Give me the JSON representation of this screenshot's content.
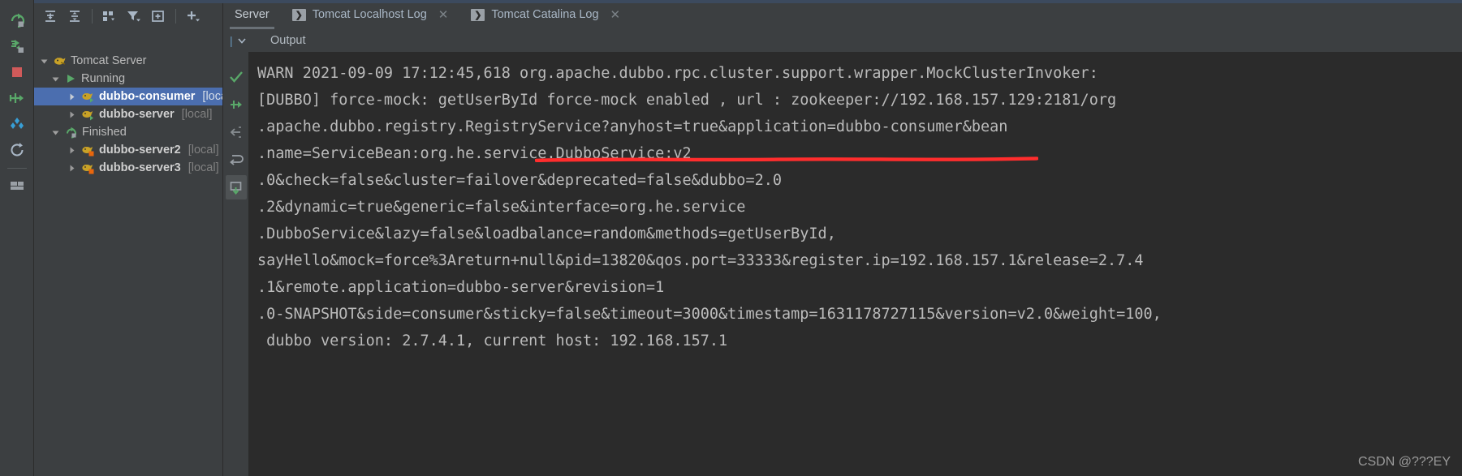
{
  "window": {
    "accent_selection": "#4b6eaf",
    "console_bg": "#2b2b2b",
    "panel_bg": "#3c3f41",
    "text_color": "#bbbbbb",
    "annotation_color": "#ff2d2d"
  },
  "left_rail": {
    "items": [
      {
        "name": "rerun-icon",
        "title": "Rerun"
      },
      {
        "name": "rerun-failed-tests-icon",
        "title": "Debug"
      },
      {
        "name": "stop-icon",
        "title": "Stop"
      },
      {
        "name": "deploy-icon",
        "title": "Deploy"
      },
      {
        "name": "edit-configurations-icon",
        "title": "Edit Configurations"
      },
      {
        "name": "restart-icon",
        "title": "Restart Server"
      },
      {
        "name": "layout-icon",
        "title": "Layout Settings"
      }
    ]
  },
  "tree_toolbar": {
    "items": [
      {
        "name": "expand-all-icon",
        "title": "Expand All"
      },
      {
        "name": "collapse-all-icon",
        "title": "Collapse All"
      },
      {
        "name": "group-by-icon",
        "title": "Group By"
      },
      {
        "name": "filter-icon",
        "title": "Filter"
      },
      {
        "name": "add-frame-icon",
        "title": "Add Frame"
      },
      {
        "name": "add-icon",
        "title": "Add"
      }
    ]
  },
  "tabs": [
    {
      "label": "Server",
      "active": true,
      "closable": false,
      "has_run_icon": false
    },
    {
      "label": "Tomcat Localhost Log",
      "active": false,
      "closable": true,
      "has_run_icon": true
    },
    {
      "label": "Tomcat Catalina Log",
      "active": false,
      "closable": true,
      "has_run_icon": true
    }
  ],
  "subbar": {
    "collapse_icon": "chevron-down-icon",
    "output_label": "Output"
  },
  "tree": {
    "nodes": [
      {
        "level": 0,
        "twisty": "down",
        "icon": "tomcat-icon",
        "label": "Tomcat Server",
        "sub": "",
        "bold": false,
        "selected": false
      },
      {
        "level": 1,
        "twisty": "down",
        "icon": "run-green-icon",
        "label": "Running",
        "sub": "",
        "bold": false,
        "selected": false
      },
      {
        "level": 2,
        "twisty": "right",
        "icon": "tomcat-run-icon",
        "label": "dubbo-consumer",
        "sub": "[local]",
        "bold": true,
        "selected": true
      },
      {
        "level": 2,
        "twisty": "right",
        "icon": "tomcat-run-icon",
        "label": "dubbo-server",
        "sub": "[local]",
        "bold": true,
        "selected": false
      },
      {
        "level": 1,
        "twisty": "down",
        "icon": "finished-icon",
        "label": "Finished",
        "sub": "",
        "bold": false,
        "selected": false
      },
      {
        "level": 2,
        "twisty": "right",
        "icon": "tomcat-stop-icon",
        "label": "dubbo-server2",
        "sub": "[local]",
        "bold": true,
        "selected": false
      },
      {
        "level": 2,
        "twisty": "right",
        "icon": "tomcat-stop-icon",
        "label": "dubbo-server3",
        "sub": "[local]",
        "bold": true,
        "selected": false
      }
    ]
  },
  "output_rail": {
    "items": [
      {
        "name": "check-green-icon",
        "title": "Toggle soft-wrap",
        "active": false
      },
      {
        "name": "rerun-green-icon",
        "title": "Rerun"
      },
      {
        "name": "scroll-to-end-icon",
        "title": "Scroll to end"
      },
      {
        "name": "soft-wrap-icon",
        "title": "Soft-Wrap"
      },
      {
        "name": "print-icon",
        "title": "Print",
        "active": true
      }
    ]
  },
  "console": {
    "lines": [
      "WARN 2021-09-09 17:12:45,618 org.apache.dubbo.rpc.cluster.support.wrapper.MockClusterInvoker:",
      "[DUBBO] force-mock: getUserById force-mock enabled , url : zookeeper://192.168.157.129:2181/org",
      ".apache.dubbo.registry.RegistryService?anyhost=true&application=dubbo-consumer&bean",
      ".name=ServiceBean:org.he.service.DubboService:v2",
      ".0&check=false&cluster=failover&deprecated=false&dubbo=2.0",
      ".2&dynamic=true&generic=false&interface=org.he.service",
      ".DubboService&lazy=false&loadbalance=random&methods=getUserById,",
      "sayHello&mock=force%3Areturn+null&pid=13820&qos.port=33333&register.ip=192.168.157.1&release=2.7.4",
      ".1&remote.application=dubbo-server&revision=1",
      ".0-SNAPSHOT&side=consumer&sticky=false&timeout=3000&timestamp=1631178727115&version=v2.0&weight=100,",
      " dubbo version: 2.7.4.1, current host: 192.168.157.1"
    ],
    "annotation": "red-underline-on-force-mock-enabled"
  },
  "watermark": {
    "text": "CSDN @???EY"
  }
}
